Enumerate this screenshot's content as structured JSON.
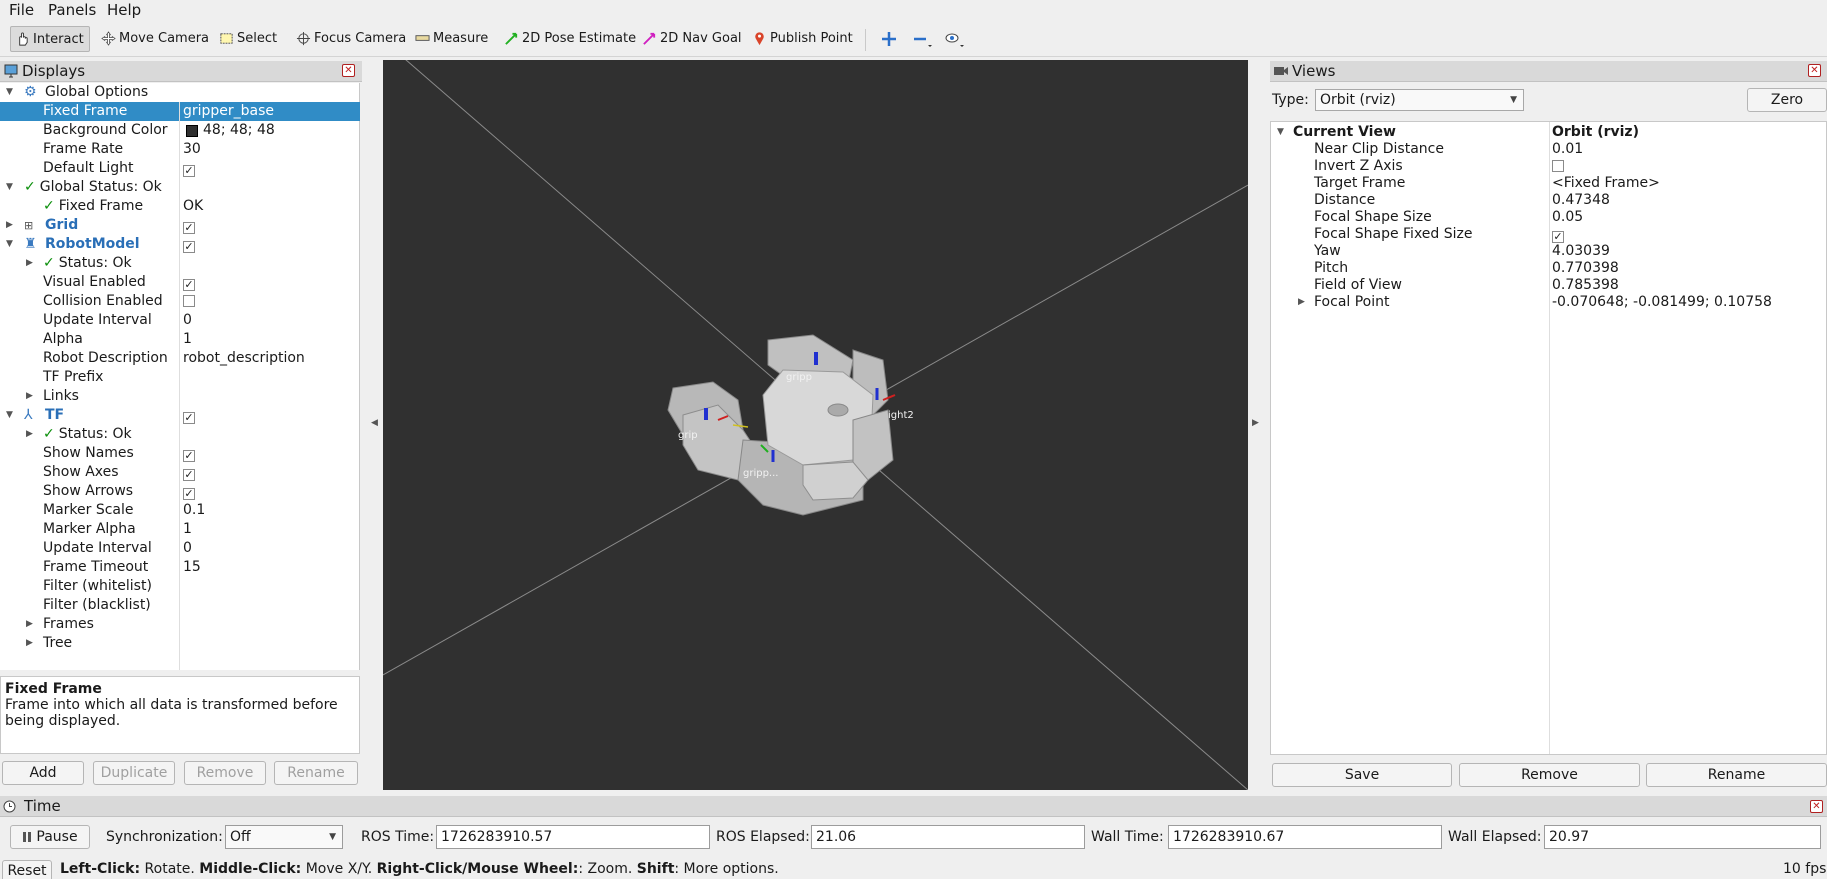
{
  "menu": [
    "File",
    "Panels",
    "Help"
  ],
  "toolbar": {
    "tools": [
      "Interact",
      "Move Camera",
      "Select",
      "Focus Camera",
      "Measure",
      "2D Pose Estimate",
      "2D Nav Goal",
      "Publish Point"
    ]
  },
  "displays": {
    "title": "Displays",
    "rows": [
      {
        "label": "Global Options",
        "value": ""
      },
      {
        "label": "Fixed Frame",
        "value": "gripper_base"
      },
      {
        "label": "Background Color",
        "value": "48; 48; 48"
      },
      {
        "label": "Frame Rate",
        "value": "30"
      },
      {
        "label": "Default Light",
        "value": ""
      },
      {
        "label": "Global Status: Ok",
        "value": ""
      },
      {
        "label": "Fixed Frame",
        "value": "OK"
      },
      {
        "label": "Grid",
        "value": ""
      },
      {
        "label": "RobotModel",
        "value": ""
      },
      {
        "label": "Status: Ok",
        "value": ""
      },
      {
        "label": "Visual Enabled",
        "value": ""
      },
      {
        "label": "Collision Enabled",
        "value": ""
      },
      {
        "label": "Update Interval",
        "value": "0"
      },
      {
        "label": "Alpha",
        "value": "1"
      },
      {
        "label": "Robot Description",
        "value": "robot_description"
      },
      {
        "label": "TF Prefix",
        "value": ""
      },
      {
        "label": "Links",
        "value": ""
      },
      {
        "label": "TF",
        "value": ""
      },
      {
        "label": "Status: Ok",
        "value": ""
      },
      {
        "label": "Show Names",
        "value": ""
      },
      {
        "label": "Show Axes",
        "value": ""
      },
      {
        "label": "Show Arrows",
        "value": ""
      },
      {
        "label": "Marker Scale",
        "value": "0.1"
      },
      {
        "label": "Marker Alpha",
        "value": "1"
      },
      {
        "label": "Update Interval",
        "value": "0"
      },
      {
        "label": "Frame Timeout",
        "value": "15"
      },
      {
        "label": "Filter (whitelist)",
        "value": ""
      },
      {
        "label": "Filter (blacklist)",
        "value": ""
      },
      {
        "label": "Frames",
        "value": ""
      },
      {
        "label": "Tree",
        "value": ""
      }
    ],
    "background_color_hex": "#303030",
    "description_title": "Fixed Frame",
    "description_text": "Frame into which all data is transformed before being displayed.",
    "buttons": [
      "Add",
      "Duplicate",
      "Remove",
      "Rename"
    ]
  },
  "viewport": {
    "frame_labels": [
      "gripp",
      "ight2",
      "grip",
      "gripp..."
    ]
  },
  "views": {
    "title": "Views",
    "type_label": "Type:",
    "type_value": "Orbit (rviz)",
    "zero_label": "Zero",
    "current_view_label": "Current View",
    "current_view_value": "Orbit (rviz)",
    "rows": [
      {
        "label": "Near Clip Distance",
        "value": "0.01"
      },
      {
        "label": "Invert Z Axis",
        "value": ""
      },
      {
        "label": "Target Frame",
        "value": "<Fixed Frame>"
      },
      {
        "label": "Distance",
        "value": "0.47348"
      },
      {
        "label": "Focal Shape Size",
        "value": "0.05"
      },
      {
        "label": "Focal Shape Fixed Size",
        "value": ""
      },
      {
        "label": "Yaw",
        "value": "4.03039"
      },
      {
        "label": "Pitch",
        "value": "0.770398"
      },
      {
        "label": "Field of View",
        "value": "0.785398"
      },
      {
        "label": "Focal Point",
        "value": "-0.070648; -0.081499; 0.10758"
      }
    ],
    "buttons": [
      "Save",
      "Remove",
      "Rename"
    ]
  },
  "time": {
    "title": "Time",
    "pause_label": "Pause",
    "sync_label": "Synchronization:",
    "sync_value": "Off",
    "ros_time_label": "ROS Time:",
    "ros_time": "1726283910.57",
    "ros_elapsed_label": "ROS Elapsed:",
    "ros_elapsed": "21.06",
    "wall_time_label": "Wall Time:",
    "wall_time": "1726283910.67",
    "wall_elapsed_label": "Wall Elapsed:",
    "wall_elapsed": "20.97"
  },
  "status": {
    "reset_label": "Reset",
    "left_click_key": "Left-Click:",
    "left_click_text": " Rotate. ",
    "middle_click_key": "Middle-Click:",
    "middle_click_text": " Move X/Y. ",
    "right_click_key": "Right-Click/Mouse Wheel:",
    "right_click_text": ": Zoom. ",
    "shift_key": "Shift",
    "shift_text": ": More options.",
    "fps": "10 fps"
  }
}
